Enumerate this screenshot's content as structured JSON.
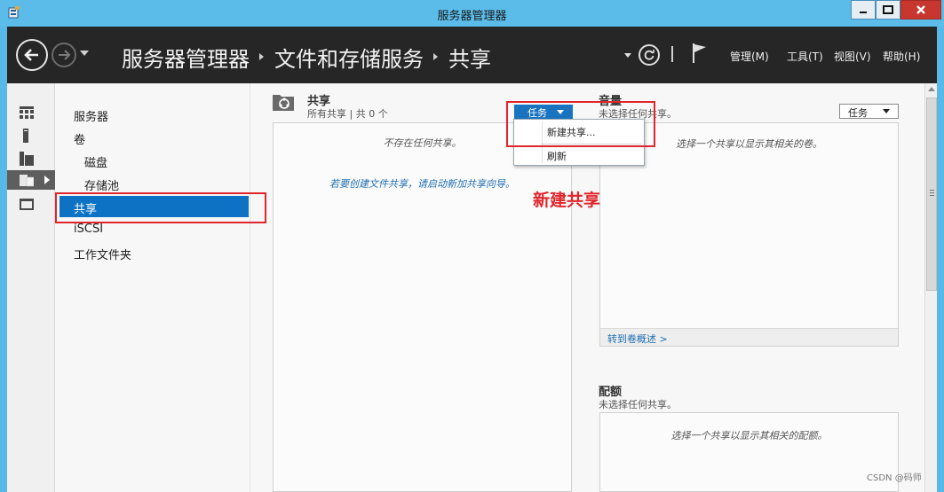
{
  "window": {
    "title": "服务器管理器"
  },
  "navbar": {
    "breadcrumb": [
      "服务器管理器",
      "文件和存储服务",
      "共享"
    ],
    "menus": [
      "管理(M)",
      "工具(T)",
      "视图(V)",
      "帮助(H)"
    ]
  },
  "sidenav": {
    "items": [
      "服务器",
      "卷",
      "磁盘",
      "存储池",
      "共享",
      "iSCSI",
      "工作文件夹"
    ],
    "selected": "共享"
  },
  "shares": {
    "title": "共享",
    "subtitle": "所有共享 | 共 0 个",
    "empty_message": "不存在任何共享。",
    "hint_link": "若要创建文件共享，请启动新加共享向导。",
    "tasks_label": "任务"
  },
  "task_menu": {
    "items": [
      "新建共享...",
      "刷新"
    ]
  },
  "annotation": "新建共享",
  "volume": {
    "title": "音量",
    "subtitle": "未选择任何共享。",
    "tasks_label": "任务",
    "message": "选择一个共享以显示其相关的卷。",
    "footer_link": "转到卷概述 >"
  },
  "quota": {
    "title": "配额",
    "subtitle": "未选择任何共享。",
    "message": "选择一个共享以显示其相关的配额。"
  },
  "watermark": "CSDN @码师",
  "colors": {
    "selection": "#0e72c4",
    "annotation_red": "#e0262b",
    "navbar": "#262626",
    "titlebar": "#5bbce9"
  }
}
